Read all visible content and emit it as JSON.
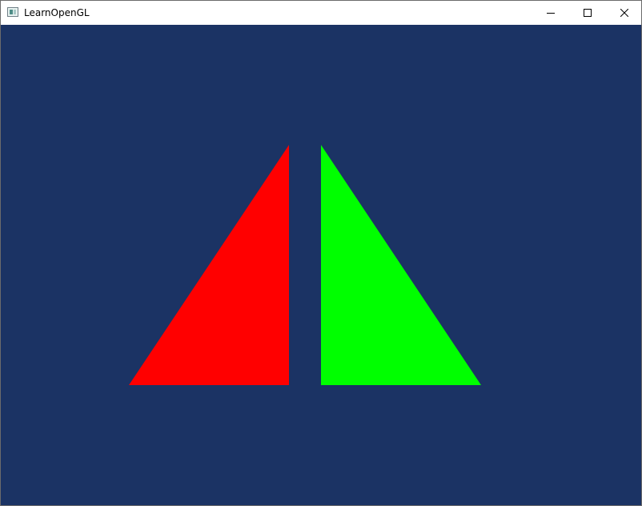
{
  "window": {
    "title": "LearnOpenGL",
    "clear_color": "#1b3364",
    "icons": {
      "app": "app-window-icon",
      "minimize": "minimize-icon",
      "maximize": "maximize-icon",
      "close": "close-icon"
    }
  },
  "scene": {
    "left_triangle": {
      "color": "#ff0000"
    },
    "right_triangle": {
      "color": "#00ff00"
    }
  }
}
